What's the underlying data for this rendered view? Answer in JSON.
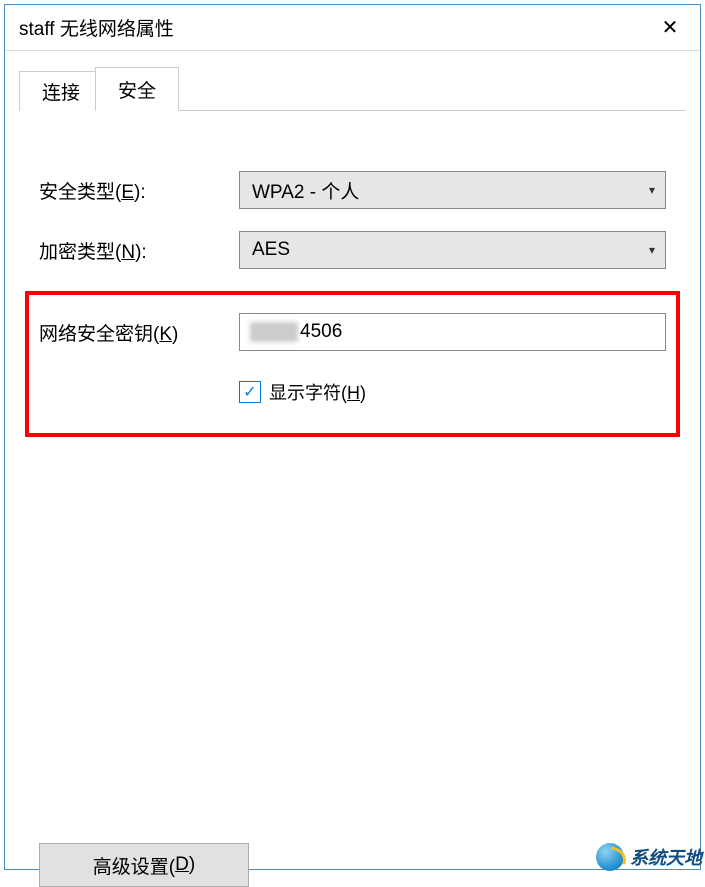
{
  "window": {
    "title": "staff 无线网络属性",
    "close": "✕"
  },
  "tabs": {
    "connection": "连接",
    "security": "安全"
  },
  "fields": {
    "security_type": {
      "label_pre": "安全类型(",
      "label_key": "E",
      "label_post": "):",
      "value": "WPA2 - 个人"
    },
    "encryption_type": {
      "label_pre": "加密类型(",
      "label_key": "N",
      "label_post": "):",
      "value": "AES"
    },
    "network_key": {
      "label_pre": "网络安全密钥(",
      "label_key": "K",
      "label_post": ")",
      "value_visible": "4506"
    },
    "show_chars": {
      "label_pre": "显示字符(",
      "label_key": "H",
      "label_post": ")",
      "checked": true
    }
  },
  "buttons": {
    "advanced": {
      "label_pre": "高级设置(",
      "label_key": "D",
      "label_post": ")"
    }
  },
  "watermark": "系统天地"
}
